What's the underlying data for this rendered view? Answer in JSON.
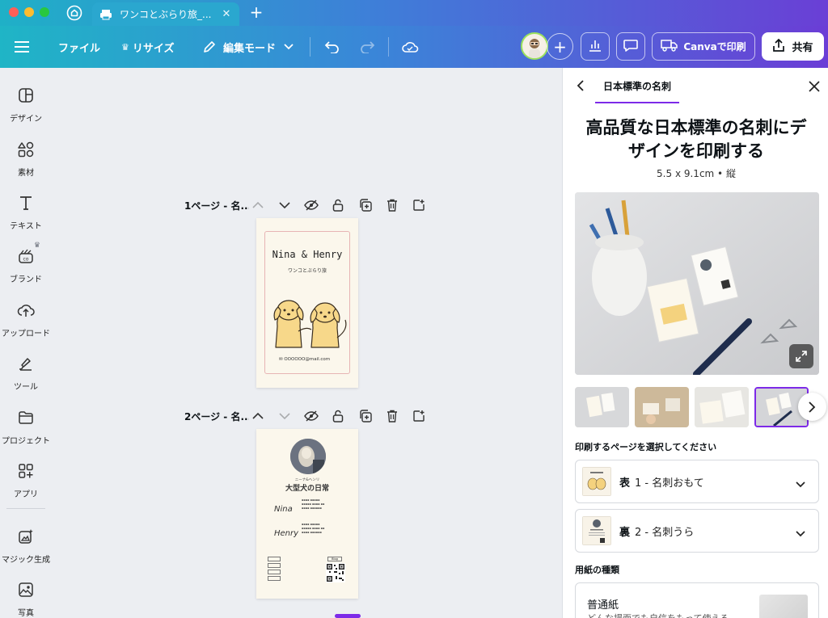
{
  "browser": {
    "tab_title": "ワンコとぶらり旅_...",
    "tab_close": "✕",
    "new_tab": "+"
  },
  "toolbar": {
    "file_label": "ファイル",
    "resize_label": "リサイズ",
    "edit_mode_label": "編集モード",
    "print_label": "Canvaで印刷",
    "share_label": "共有",
    "add_label": "+"
  },
  "sidebar": {
    "items": [
      {
        "label": "デザイン",
        "icon": "design-icon"
      },
      {
        "label": "素材",
        "icon": "elements-icon"
      },
      {
        "label": "テキスト",
        "icon": "text-icon"
      },
      {
        "label": "ブランド",
        "icon": "brand-icon"
      },
      {
        "label": "アップロード",
        "icon": "upload-icon"
      },
      {
        "label": "ツール",
        "icon": "tools-icon"
      },
      {
        "label": "プロジェクト",
        "icon": "folder-icon"
      },
      {
        "label": "アプリ",
        "icon": "apps-icon"
      },
      {
        "label": "マジック生成",
        "icon": "magic-icon"
      },
      {
        "label": "写真",
        "icon": "photo-icon"
      }
    ]
  },
  "canvas": {
    "pages": [
      {
        "title": "1ページ - 名..."
      },
      {
        "title": "2ページ - 名..."
      }
    ],
    "card1": {
      "names": "Nina & Henry",
      "subtitle": "ワンコとぶらり旅",
      "email": "✉ OOOOOO@mail.com"
    },
    "card2": {
      "tagline": "ニーナ&ヘンリ",
      "title": "大型犬の日常",
      "name1": "Nina",
      "name2": "Henry",
      "blog": "Blog"
    }
  },
  "panel": {
    "tab_label": "日本標準の名刺",
    "heading_line1": "高品質な日本標準の名刺にデ",
    "heading_line2": "ザインを印刷する",
    "size": "5.5 x 9.1cm • 縦",
    "select_pages_label": "印刷するページを選択してください",
    "front": {
      "side": "表",
      "name": "1 - 名刺おもて"
    },
    "back": {
      "side": "裏",
      "name": "2 - 名刺うら"
    },
    "paper_type_label": "用紙の種類",
    "paper": {
      "name": "普通紙",
      "desc": "どんな場面でも自信をもって使える"
    }
  },
  "colors": {
    "accent": "#7d2ae8",
    "toolbar_gradient_start": "#1fb5c6",
    "toolbar_gradient_end": "#6b3dd6"
  }
}
